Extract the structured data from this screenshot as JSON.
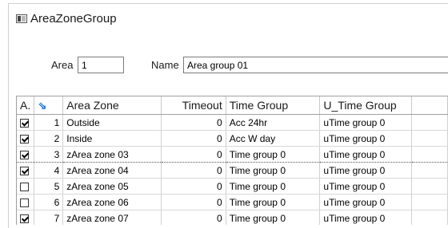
{
  "window": {
    "title": "AreaZoneGroup"
  },
  "form": {
    "area_label": "Area",
    "area_value": "1",
    "name_label": "Name",
    "name_value": "Area group 01"
  },
  "table": {
    "columns": [
      {
        "key": "active",
        "label": "A."
      },
      {
        "key": "index",
        "label": ""
      },
      {
        "key": "area_zone",
        "label": "Area Zone"
      },
      {
        "key": "timeout",
        "label": "Timeout"
      },
      {
        "key": "time_group",
        "label": "Time Group"
      },
      {
        "key": "u_time_group",
        "label": "U_Time Group"
      }
    ],
    "rows": [
      {
        "checked": true,
        "index": "1",
        "area_zone": "Outside",
        "timeout": "0",
        "time_group": "Acc 24hr",
        "u_time_group": "uTime group 0"
      },
      {
        "checked": true,
        "index": "2",
        "area_zone": "Inside",
        "timeout": "0",
        "time_group": "Acc W day",
        "u_time_group": "uTime group 0"
      },
      {
        "checked": true,
        "index": "3",
        "area_zone": "zArea zone 03",
        "timeout": "0",
        "time_group": "Time group 0",
        "u_time_group": "uTime group 0"
      },
      {
        "checked": true,
        "index": "4",
        "area_zone": "zArea zone 04",
        "timeout": "0",
        "time_group": "Time group 0",
        "u_time_group": "uTime group 0"
      },
      {
        "checked": false,
        "index": "5",
        "area_zone": "zArea zone 05",
        "timeout": "0",
        "time_group": "Time group 0",
        "u_time_group": "uTime group 0"
      },
      {
        "checked": false,
        "index": "6",
        "area_zone": "zArea zone 06",
        "timeout": "0",
        "time_group": "Time group 0",
        "u_time_group": "uTime group 0"
      },
      {
        "checked": true,
        "index": "7",
        "area_zone": "zArea zone 07",
        "timeout": "0",
        "time_group": "Time group 0",
        "u_time_group": "uTime group 0"
      }
    ]
  },
  "icons": {
    "app": "window-icon",
    "sort": "sort-arrows-icon"
  },
  "colors": {
    "sort_icon": "#1e78d8"
  }
}
